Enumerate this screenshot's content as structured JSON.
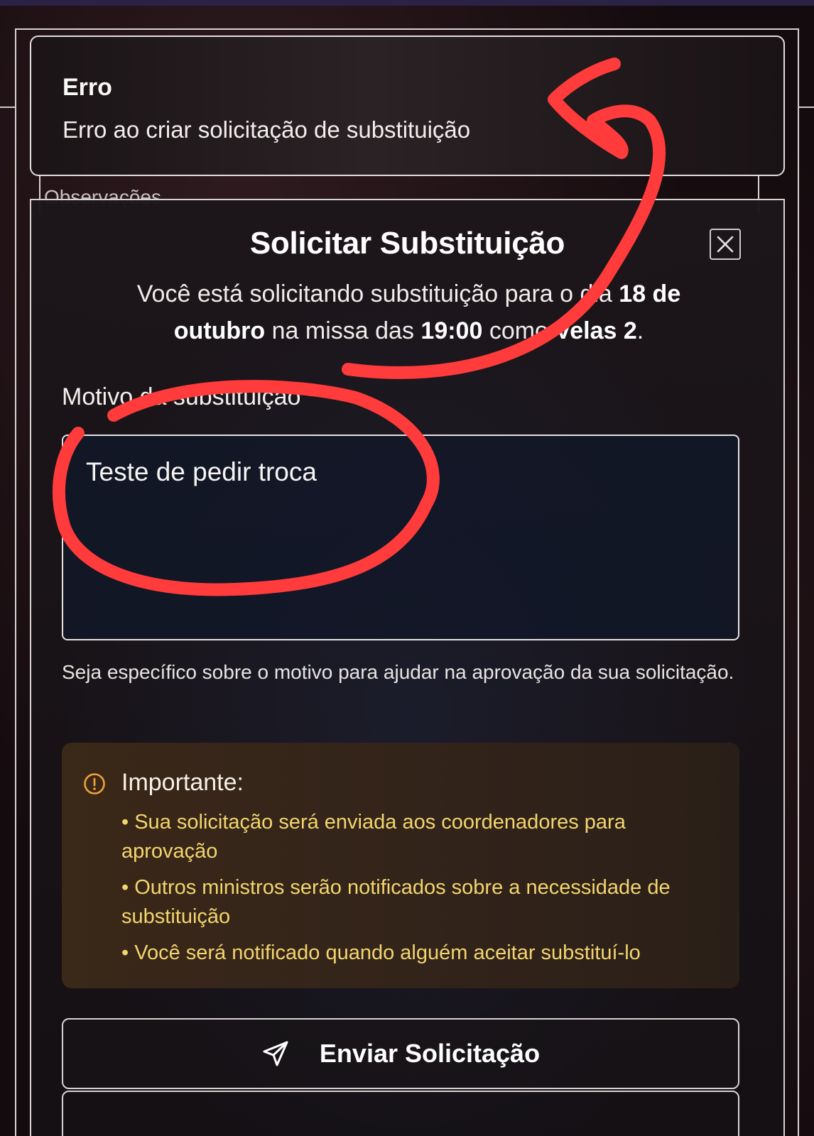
{
  "background": {
    "behind_card_label": "Observações"
  },
  "toast": {
    "title": "Erro",
    "description": "Erro ao criar solicitação de substituição"
  },
  "dialog": {
    "title": "Solicitar Substituição",
    "desc_prefix": "Você está solicitando substituição para o dia ",
    "date": "18 de outubro",
    "desc_mid": " na missa das ",
    "time": "19:00",
    "desc_mid2": " como ",
    "role": "Velas 2",
    "desc_suffix": ".",
    "close_icon": "close-icon",
    "reason": {
      "label": "Motivo da substituição",
      "required_mark": "*",
      "value": "Teste de pedir troca",
      "help": "Seja específico sobre o motivo para ajudar na aprovação da sua solicitação."
    },
    "notice": {
      "icon": "alert-circle-icon",
      "title": "Importante:",
      "items": [
        "Sua solicitação será enviada aos coordenadores para aprovação",
        "Outros ministros serão notificados sobre a necessidade de substituição",
        "Você será notificado quando alguém aceitar substituí-lo"
      ]
    },
    "send_button": {
      "icon": "send-icon",
      "label": "Enviar Solicitação"
    }
  },
  "colors": {
    "annotation": "#ff3b3b",
    "notice_text": "#f3d56e",
    "notice_icon": "#f0a13a"
  }
}
